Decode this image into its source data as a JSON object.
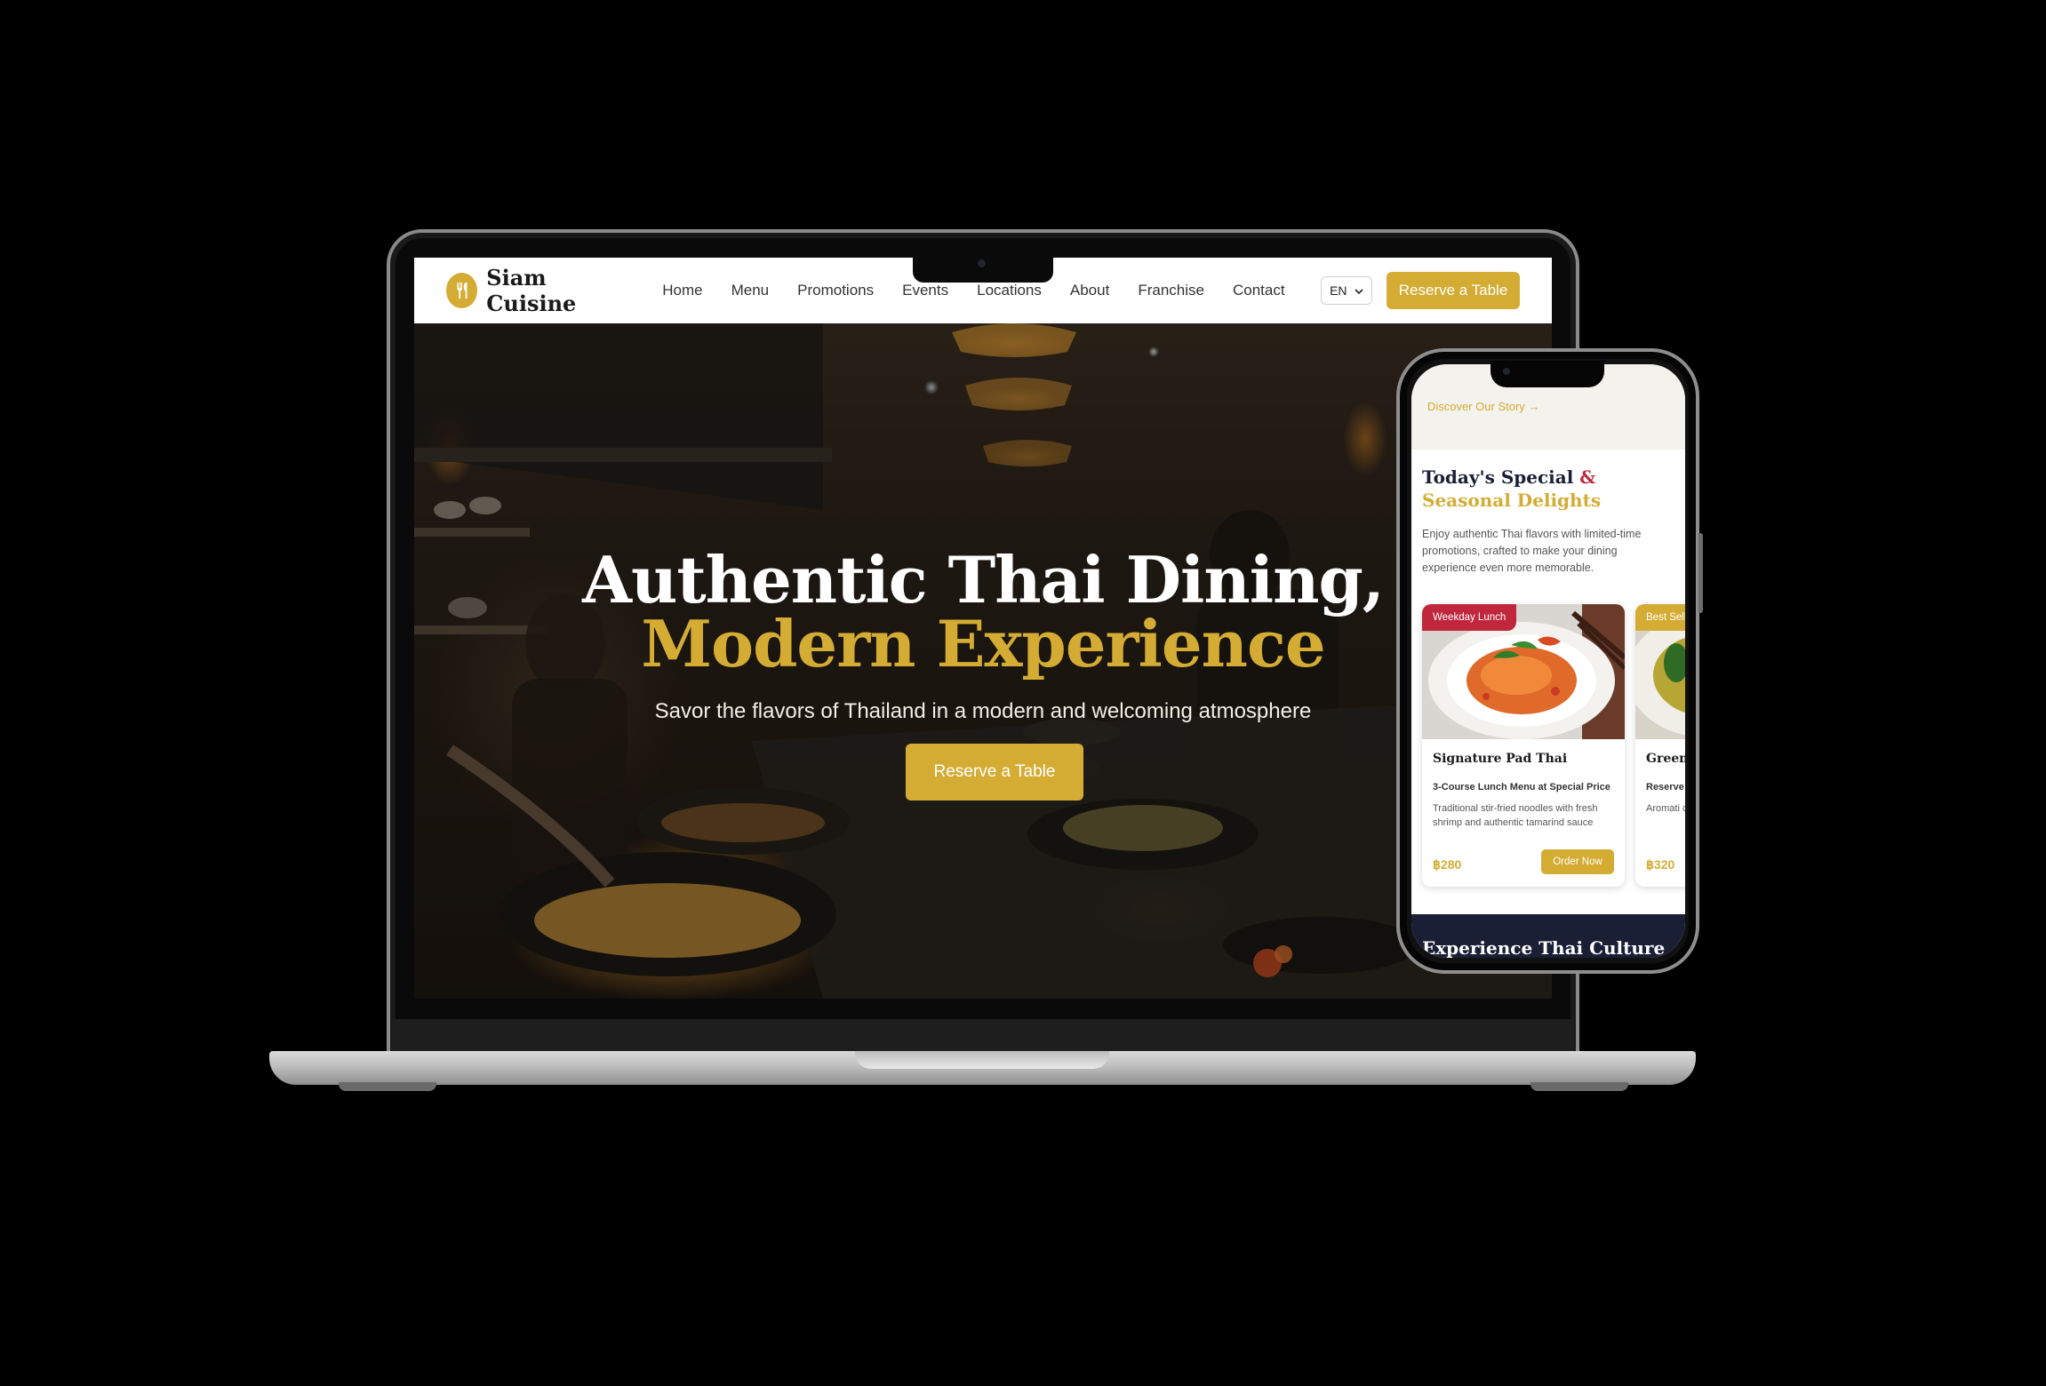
{
  "brand": {
    "name": "Siam Cuisine",
    "accent": "#d4ac34",
    "navy": "#1a1f36",
    "red": "#c0273d"
  },
  "nav": {
    "items": [
      "Home",
      "Menu",
      "Promotions",
      "Events",
      "Locations",
      "About",
      "Franchise",
      "Contact"
    ],
    "language": "EN",
    "cta": "Reserve a Table"
  },
  "hero": {
    "title_line1": "Authentic Thai Dining,",
    "title_line2": "Modern Experience",
    "subtitle": "Savor the flavors of Thailand in a modern and welcoming atmosphere",
    "cta": "Reserve a Table"
  },
  "mobile": {
    "top_link": "Discover Our Story →",
    "section_title_a": "Today's Special",
    "section_title_amp": "&",
    "section_title_b": "Seasonal Delights",
    "section_desc": "Enjoy authentic Thai flavors with limited-time promotions, crafted to make your dining experience even more memorable.",
    "cards": [
      {
        "tag": "Weekday Lunch",
        "title": "Signature Pad Thai",
        "subtitle": "3-Course Lunch Menu at Special Price",
        "description": "Traditional stir-fried noodles with fresh shrimp and authentic tamarind sauce",
        "price": "฿280",
        "button": "Order Now"
      },
      {
        "tag": "Best Sell",
        "title": "Green",
        "subtitle": "Reserve",
        "description": "Aromati chicken",
        "price": "฿320",
        "button": ""
      }
    ],
    "bottom_title": "Experience Thai Culture"
  }
}
